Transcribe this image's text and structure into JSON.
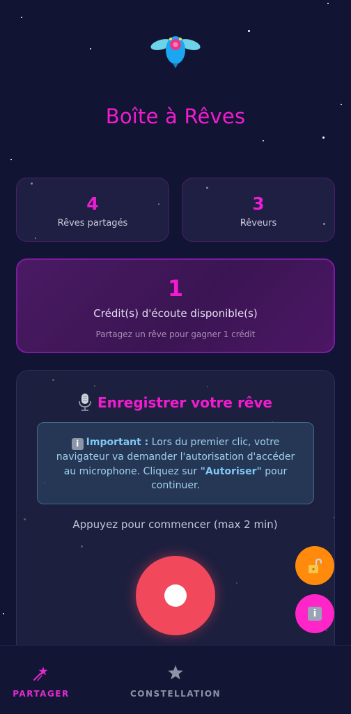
{
  "app": {
    "title": "Boîte à Rêves"
  },
  "stats": [
    {
      "value": "4",
      "label": "Rêves partagés"
    },
    {
      "value": "3",
      "label": "Rêveurs"
    }
  ],
  "credits": {
    "value": "1",
    "label": "Crédit(s) d'écoute disponible(s)",
    "hint": "Partagez un rêve pour gagner 1 crédit"
  },
  "record": {
    "title": "Enregistrer votre rêve",
    "info_icon": "i",
    "info_strong": "Important :",
    "info_text_1": " Lors du premier clic, votre navigateur va demander l'autorisation d'accéder au microphone. Cliquez sur ",
    "info_quote": "\"Autoriser\"",
    "info_text_2": " pour continuer.",
    "prompt": "Appuyez pour commencer (max 2 min)"
  },
  "fab_info_glyph": "i",
  "nav": {
    "items": [
      {
        "label": "PARTAGER",
        "icon": "shooting-star-icon",
        "active": true
      },
      {
        "label": "CONSTELLATION",
        "icon": "star-icon",
        "active": false
      }
    ]
  },
  "colors": {
    "accent": "#f21bd0",
    "background": "#111533",
    "record": "#f2485c",
    "lock_fab": "#ff8a0c",
    "info_fab": "#ff25c8"
  }
}
